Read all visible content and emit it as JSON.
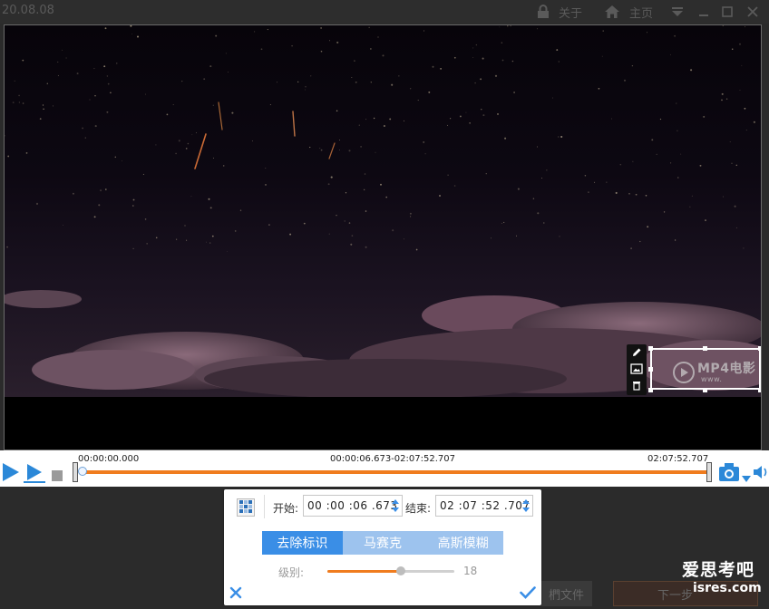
{
  "window": {
    "title": "20.08.08",
    "about_label": "关于",
    "home_label": "主页"
  },
  "video": {
    "watermark_text": "MP4电影",
    "watermark_sub": "www."
  },
  "timeline": {
    "start_time": "00:00:00.000",
    "range": "00:00:06.673-02:07:52.707",
    "end_time": "02:07:52.707",
    "played_fraction": 0.0
  },
  "panel": {
    "start_label": "开始:",
    "start_value": "00 :00 :06 .673",
    "end_label": "结束:",
    "end_value": "02 :07 :52 .707",
    "tabs": [
      {
        "label": "去除标识",
        "active": true
      },
      {
        "label": "马赛克",
        "active": false
      },
      {
        "label": "高斯模糊",
        "active": false
      }
    ],
    "level_label": "级别:",
    "level_value": "18",
    "level_fraction": 0.58
  },
  "bottom": {
    "open_file_label": "椚文件",
    "next_label": "下一步"
  },
  "brand": {
    "name": "爱思考吧",
    "site": "isres.com"
  },
  "colors": {
    "accent_orange": "#f07c1e",
    "tab_active": "#3a8ee6",
    "tab_inactive": "#9dc3ee",
    "play_blue": "#2b88d8"
  }
}
